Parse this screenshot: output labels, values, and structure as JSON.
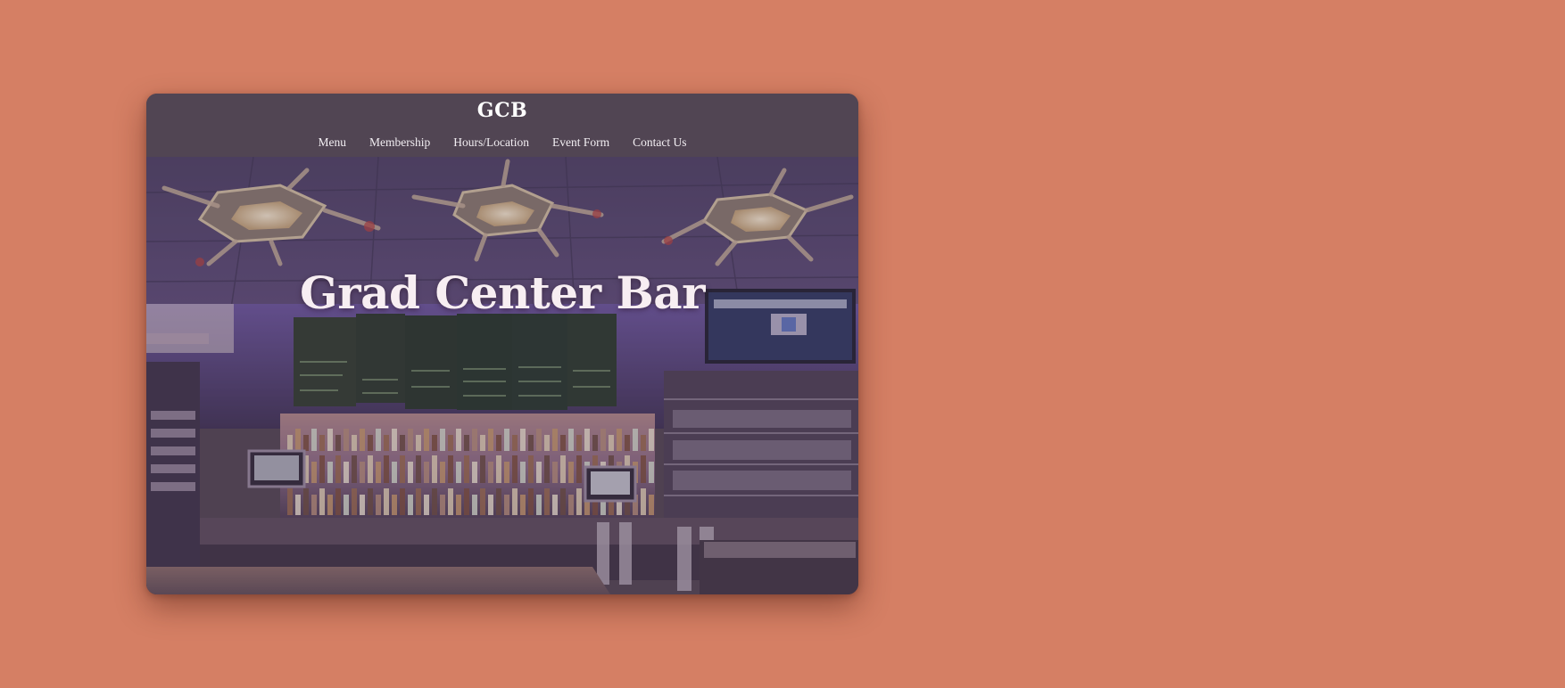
{
  "page": {
    "background_color": "#d57f64"
  },
  "header": {
    "logo": "GCB",
    "background_color": "#514553"
  },
  "nav": {
    "items": [
      {
        "label": "Menu"
      },
      {
        "label": "Membership"
      },
      {
        "label": "Hours/Location"
      },
      {
        "label": "Event Form"
      },
      {
        "label": "Contact Us"
      }
    ]
  },
  "hero": {
    "title": "Grad Center Bar",
    "image_description_icon": "bar-interior-photo"
  }
}
